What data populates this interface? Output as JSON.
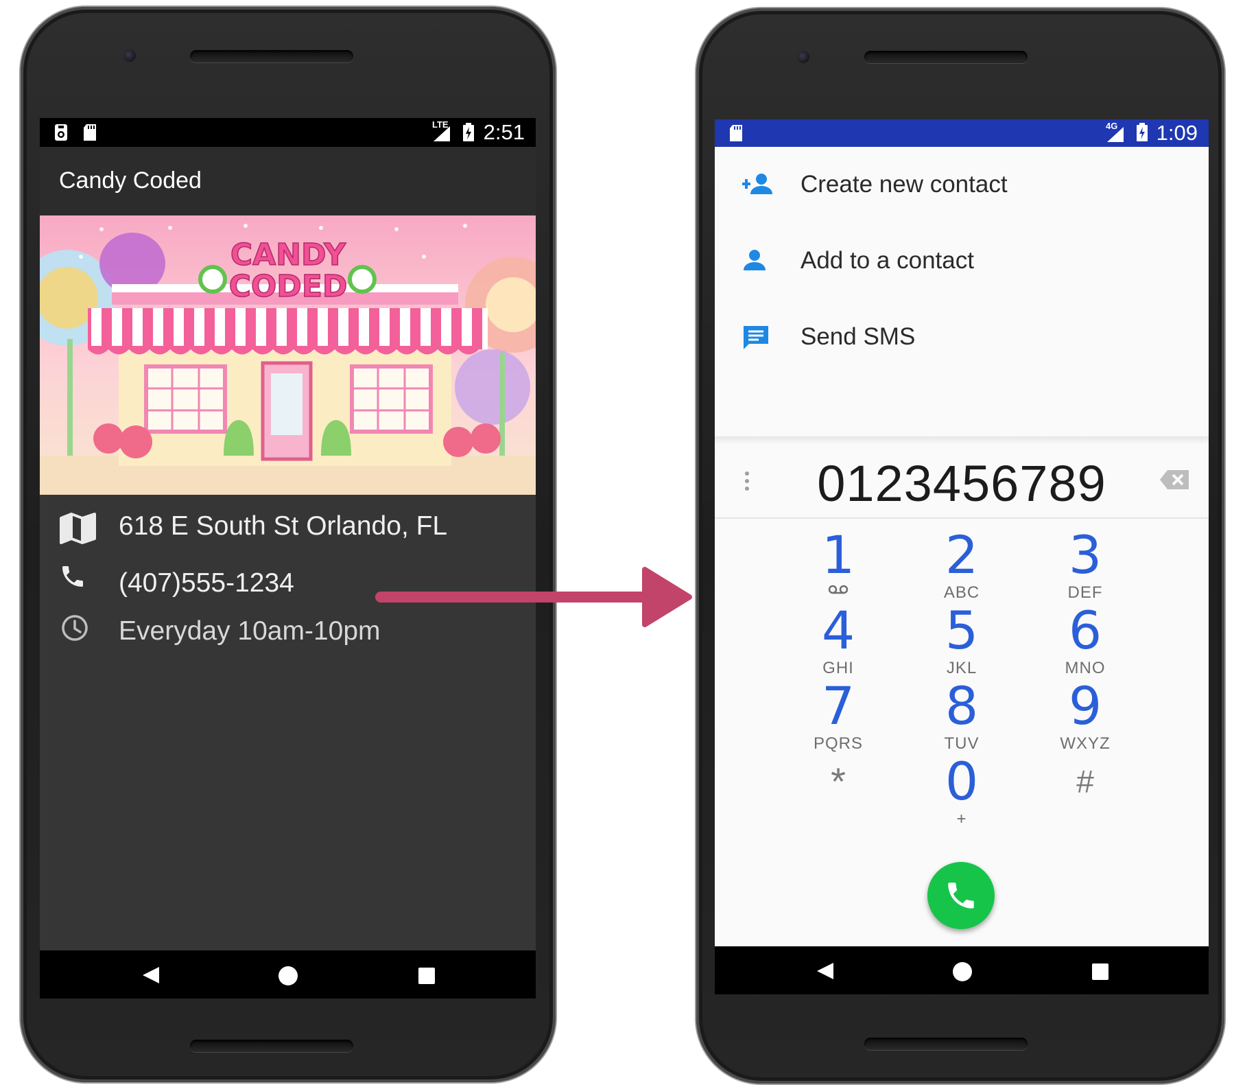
{
  "left_phone": {
    "status_bar": {
      "time": "2:51",
      "network": "LTE"
    },
    "app_title": "Candy Coded",
    "banner": {
      "line1": "CANDY",
      "line2": "CODED"
    },
    "info": {
      "address": "618 E South St Orlando, FL",
      "phone": "(407)555-1234",
      "hours": "Everyday 10am-10pm"
    }
  },
  "right_phone": {
    "status_bar": {
      "time": "1:09",
      "network": "4G"
    },
    "options": [
      {
        "label": "Create new contact",
        "icon": "add-person-icon"
      },
      {
        "label": "Add to a contact",
        "icon": "person-icon"
      },
      {
        "label": "Send SMS",
        "icon": "message-icon"
      }
    ],
    "dialed_number": "0123456789",
    "keypad": [
      {
        "num": "1",
        "letters": ""
      },
      {
        "num": "2",
        "letters": "ABC"
      },
      {
        "num": "3",
        "letters": "DEF"
      },
      {
        "num": "4",
        "letters": "GHI"
      },
      {
        "num": "5",
        "letters": "JKL"
      },
      {
        "num": "6",
        "letters": "MNO"
      },
      {
        "num": "7",
        "letters": "PQRS"
      },
      {
        "num": "8",
        "letters": "TUV"
      },
      {
        "num": "9",
        "letters": "WXYZ"
      },
      {
        "num": "*",
        "letters": ""
      },
      {
        "num": "0",
        "letters": "+"
      },
      {
        "num": "#",
        "letters": ""
      }
    ]
  },
  "colors": {
    "arrow": "#c2446b",
    "dialer_accent": "#2b5fd9",
    "call_button": "#17c44a",
    "right_status_bar": "#1f37b1",
    "contact_icon": "#1e88e5"
  }
}
